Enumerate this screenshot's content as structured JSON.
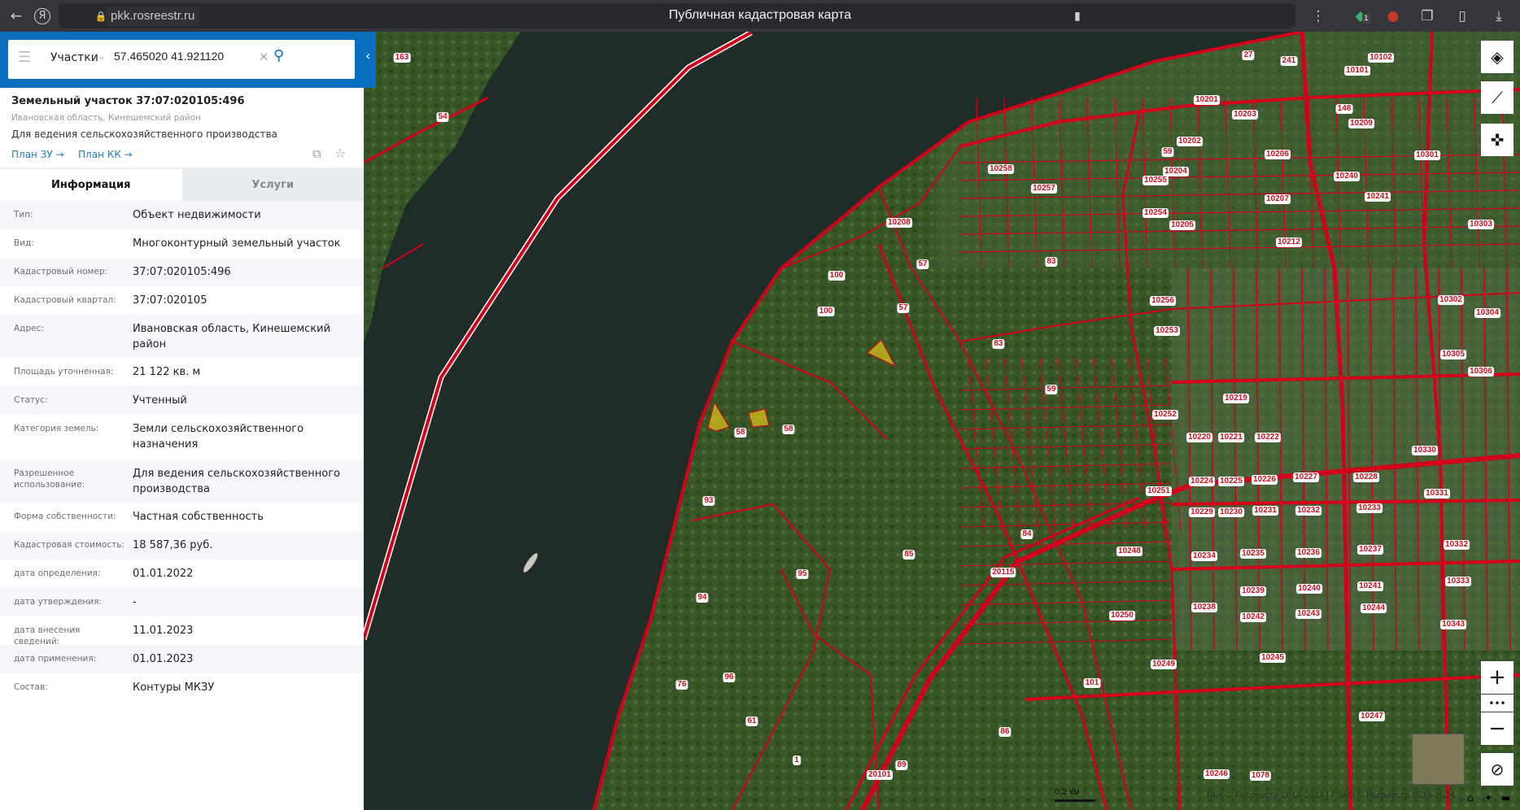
{
  "browser": {
    "url": "pkk.rosreestr.ru",
    "title": "Публичная кадастровая карта",
    "extension_badge": "1",
    "icons": [
      "back-arrow-icon",
      "yandex-icon",
      "reload-icon",
      "lock-icon",
      "bookmark-icon",
      "more-icon",
      "shield-extension-icon",
      "avatar-extension-icon",
      "tabs-icon",
      "collections-icon",
      "download-icon"
    ]
  },
  "search": {
    "type_label": "Участки",
    "query": "57.465020 41.921120"
  },
  "card": {
    "title": "Земельный участок 37:07:020105:496",
    "region": "Ивановская область, Кинешемский район",
    "purpose": "Для ведения сельскохозяйственного производства",
    "links": [
      "План ЗУ →",
      "План КК →"
    ]
  },
  "tabs": [
    {
      "label": "Информация",
      "active": true
    },
    {
      "label": "Услуги",
      "active": false
    }
  ],
  "info": [
    {
      "label": "Тип:",
      "value": "Объект недвижимости"
    },
    {
      "label": "Вид:",
      "value": "Многоконтурный земельный участок"
    },
    {
      "label": "Кадастровый номер:",
      "value": "37:07:020105:496",
      "link": true
    },
    {
      "label": "Кадастровый квартал:",
      "value": "37:07:020105",
      "link": true
    },
    {
      "label": "Адрес:",
      "value": "Ивановская область, Кинешемский район"
    },
    {
      "label": "Площадь уточненная:",
      "value": "21 122 кв. м"
    },
    {
      "label": "Статус:",
      "value": "Учтенный"
    },
    {
      "label": "Категория земель:",
      "value": "Земли сельскохозяйственного назначения"
    },
    {
      "label": "Разрешенное использование:",
      "value": "Для ведения сельскохозяйственного производства"
    },
    {
      "label": "Форма собственности:",
      "value": "Частная собственность"
    },
    {
      "label": "Кадастровая стоимость:",
      "value": "18 587,36 руб."
    },
    {
      "label": "дата определения:",
      "value": "01.01.2022"
    },
    {
      "label": "дата утверждения:",
      "value": "-"
    },
    {
      "label": "дата внесения сведений:",
      "value": "11.01.2023"
    },
    {
      "label": "дата применения:",
      "value": "01.01.2023"
    },
    {
      "label": "Состав:",
      "value": "Контуры МКЗУ",
      "link": true
    }
  ],
  "map": {
    "labels": [
      "54",
      "163",
      "10201",
      "27",
      "241",
      "10203",
      "10202",
      "59",
      "10206",
      "10258",
      "10257",
      "10255",
      "10204",
      "10254",
      "10207",
      "10208",
      "10205",
      "83",
      "57",
      "100",
      "100",
      "57",
      "83",
      "10256",
      "10253",
      "59",
      "58",
      "58",
      "10252",
      "10251",
      "93",
      "85",
      "95",
      "94",
      "20115",
      "10248",
      "10250",
      "10249",
      "10245",
      "96",
      "76",
      "61",
      "86",
      "10246",
      "1078",
      "10247",
      "10101",
      "10102",
      "148",
      "10209",
      "10240",
      "10241",
      "10212",
      "10302",
      "10304",
      "10305",
      "10306",
      "10330",
      "10331",
      "10332",
      "10333",
      "10227",
      "10228",
      "10226",
      "10232",
      "10233",
      "10236",
      "10237",
      "10240",
      "10241",
      "10243",
      "10244",
      "10242",
      "10238",
      "10239",
      "10234",
      "10235",
      "10229",
      "10230",
      "10231",
      "10224",
      "10225",
      "10220",
      "10221",
      "10222",
      "10219",
      "10301",
      "10303",
      "101",
      "84",
      "89",
      "20101",
      "1",
      "10343"
    ],
    "scale": "0,2 км",
    "attribution": "ПКК © Росреестр 2010-2024 | ГЭКО © Росреестр 2019-2024",
    "colors": {
      "parcel": "#d4001a",
      "selected": "#d8c21a",
      "water": "#1f2c27",
      "land": "#3b5a2c",
      "accent": "#0a6fbf"
    }
  }
}
